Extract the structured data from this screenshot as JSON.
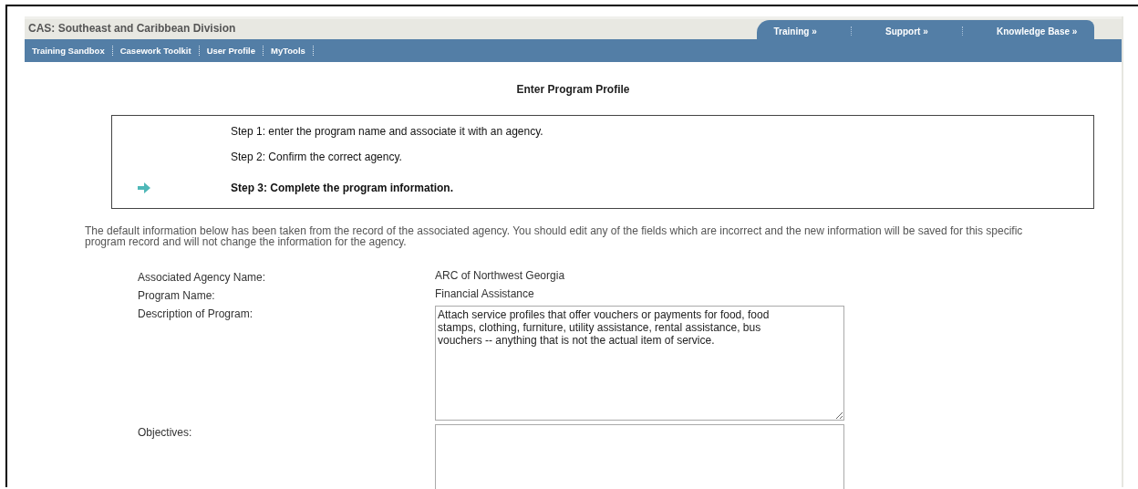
{
  "header": {
    "title": "CAS: Southeast and Caribbean Division",
    "top_links": [
      "Training »",
      "Support »",
      "Knowledge Base »"
    ],
    "nav": [
      "Training Sandbox",
      "Casework Toolkit",
      "User Profile",
      "MyTools"
    ]
  },
  "page_title": "Enter Program Profile",
  "steps": [
    {
      "label": "Step 1: enter the program name and associate it with an agency.",
      "current": false
    },
    {
      "label": "Step 2: Confirm the correct agency.",
      "current": false
    },
    {
      "label": "Step 3: Complete the program information.",
      "current": true
    }
  ],
  "intro": "The default information below has been taken from the record of the associated agency. You should edit any of the fields which are incorrect and the new information will be saved for this specific program record and will not change the information for the agency.",
  "fields": [
    {
      "label": "Associated Agency Name:",
      "kind": "text",
      "value": "ARC of Northwest Georgia"
    },
    {
      "label": "Program Name:",
      "kind": "text",
      "value": "Financial Assistance"
    },
    {
      "label": "Description of Program:",
      "kind": "textarea",
      "value": "Attach service profiles that offer vouchers or payments for food, food stamps, clothing, furniture, utility assistance, rental assistance, bus vouchers -- anything that is not the actual item of service."
    },
    {
      "label": "Objectives:",
      "kind": "textarea"
    }
  ]
}
